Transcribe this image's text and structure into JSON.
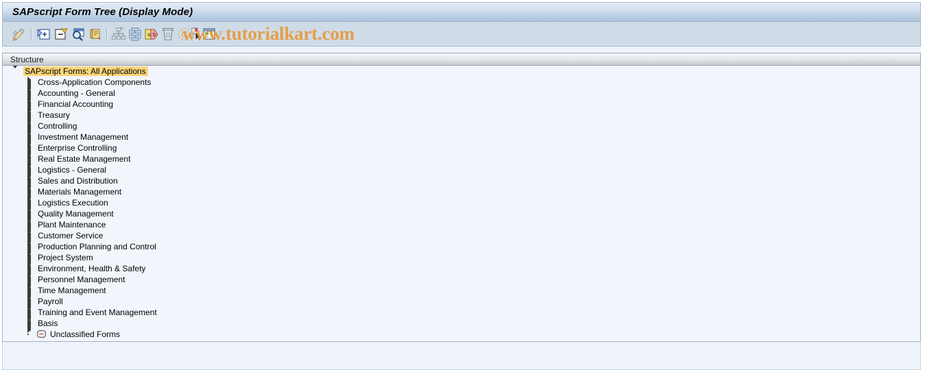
{
  "window": {
    "title": "SAPscript Form Tree (Display Mode)"
  },
  "watermark": {
    "text": "www.tutorialkart.com",
    "color": "#e79a3c"
  },
  "toolbar": {
    "buttons": [
      {
        "name": "display-change-button",
        "icon": "pencil-icon",
        "tooltip": "Display <-> Change"
      },
      {
        "name": "expand-node-button",
        "icon": "expand-plus-icon",
        "tooltip": "Expand Node"
      },
      {
        "name": "collapse-node-button",
        "icon": "collapse-minus-icon",
        "tooltip": "Collapse Node"
      },
      {
        "name": "find-button",
        "icon": "magnifier-icon",
        "tooltip": "Find"
      },
      {
        "name": "form-button",
        "icon": "scroll-form-icon",
        "tooltip": "Form"
      },
      {
        "name": "hierarchy-button",
        "icon": "hierarchy-icon",
        "tooltip": "Hierarchy"
      },
      {
        "name": "structure-button",
        "icon": "structure-icon",
        "tooltip": "Structure"
      },
      {
        "name": "compare-button",
        "icon": "compare-ab-icon",
        "tooltip": "Compare"
      },
      {
        "name": "delete-button",
        "icon": "trash-icon",
        "tooltip": "Delete"
      },
      {
        "name": "copyright-button",
        "icon": "copyright-icon",
        "tooltip": "Information"
      },
      {
        "name": "select-button",
        "icon": "cursor-arrow-icon",
        "tooltip": "Select"
      },
      {
        "name": "list-button",
        "icon": "list-window-icon",
        "tooltip": "List"
      }
    ]
  },
  "structure_header": {
    "label": "Structure"
  },
  "tree": {
    "root": {
      "label": "SAPscript Forms: All Applications",
      "expanded": true,
      "highlight_color": "#fcd67b"
    },
    "children": [
      {
        "label": "Cross-Application Components",
        "expanded": false,
        "type": "node"
      },
      {
        "label": "Accounting - General",
        "expanded": false,
        "type": "node"
      },
      {
        "label": "Financial Accounting",
        "expanded": false,
        "type": "node"
      },
      {
        "label": "Treasury",
        "expanded": false,
        "type": "node"
      },
      {
        "label": "Controlling",
        "expanded": false,
        "type": "node"
      },
      {
        "label": "Investment Management",
        "expanded": false,
        "type": "node"
      },
      {
        "label": "Enterprise Controlling",
        "expanded": false,
        "type": "node"
      },
      {
        "label": "Real Estate Management",
        "expanded": false,
        "type": "node"
      },
      {
        "label": "Logistics - General",
        "expanded": false,
        "type": "node"
      },
      {
        "label": "Sales and Distribution",
        "expanded": false,
        "type": "node"
      },
      {
        "label": "Materials Management",
        "expanded": false,
        "type": "node"
      },
      {
        "label": "Logistics Execution",
        "expanded": false,
        "type": "node"
      },
      {
        "label": "Quality Management",
        "expanded": false,
        "type": "node"
      },
      {
        "label": "Plant Maintenance",
        "expanded": false,
        "type": "node"
      },
      {
        "label": "Customer Service",
        "expanded": false,
        "type": "node"
      },
      {
        "label": "Production Planning and Control",
        "expanded": false,
        "type": "node"
      },
      {
        "label": "Project System",
        "expanded": false,
        "type": "node"
      },
      {
        "label": "Environment, Health & Safety",
        "expanded": false,
        "type": "node"
      },
      {
        "label": "Personnel Management",
        "expanded": false,
        "type": "node"
      },
      {
        "label": "Time Management",
        "expanded": false,
        "type": "node"
      },
      {
        "label": "Payroll",
        "expanded": false,
        "type": "node"
      },
      {
        "label": "Training and Event Management",
        "expanded": false,
        "type": "node"
      },
      {
        "label": "Basis",
        "expanded": false,
        "type": "node"
      }
    ],
    "leaf": {
      "label": "Unclassified Forms",
      "type": "leaf",
      "icon": "minus-box-icon"
    }
  }
}
